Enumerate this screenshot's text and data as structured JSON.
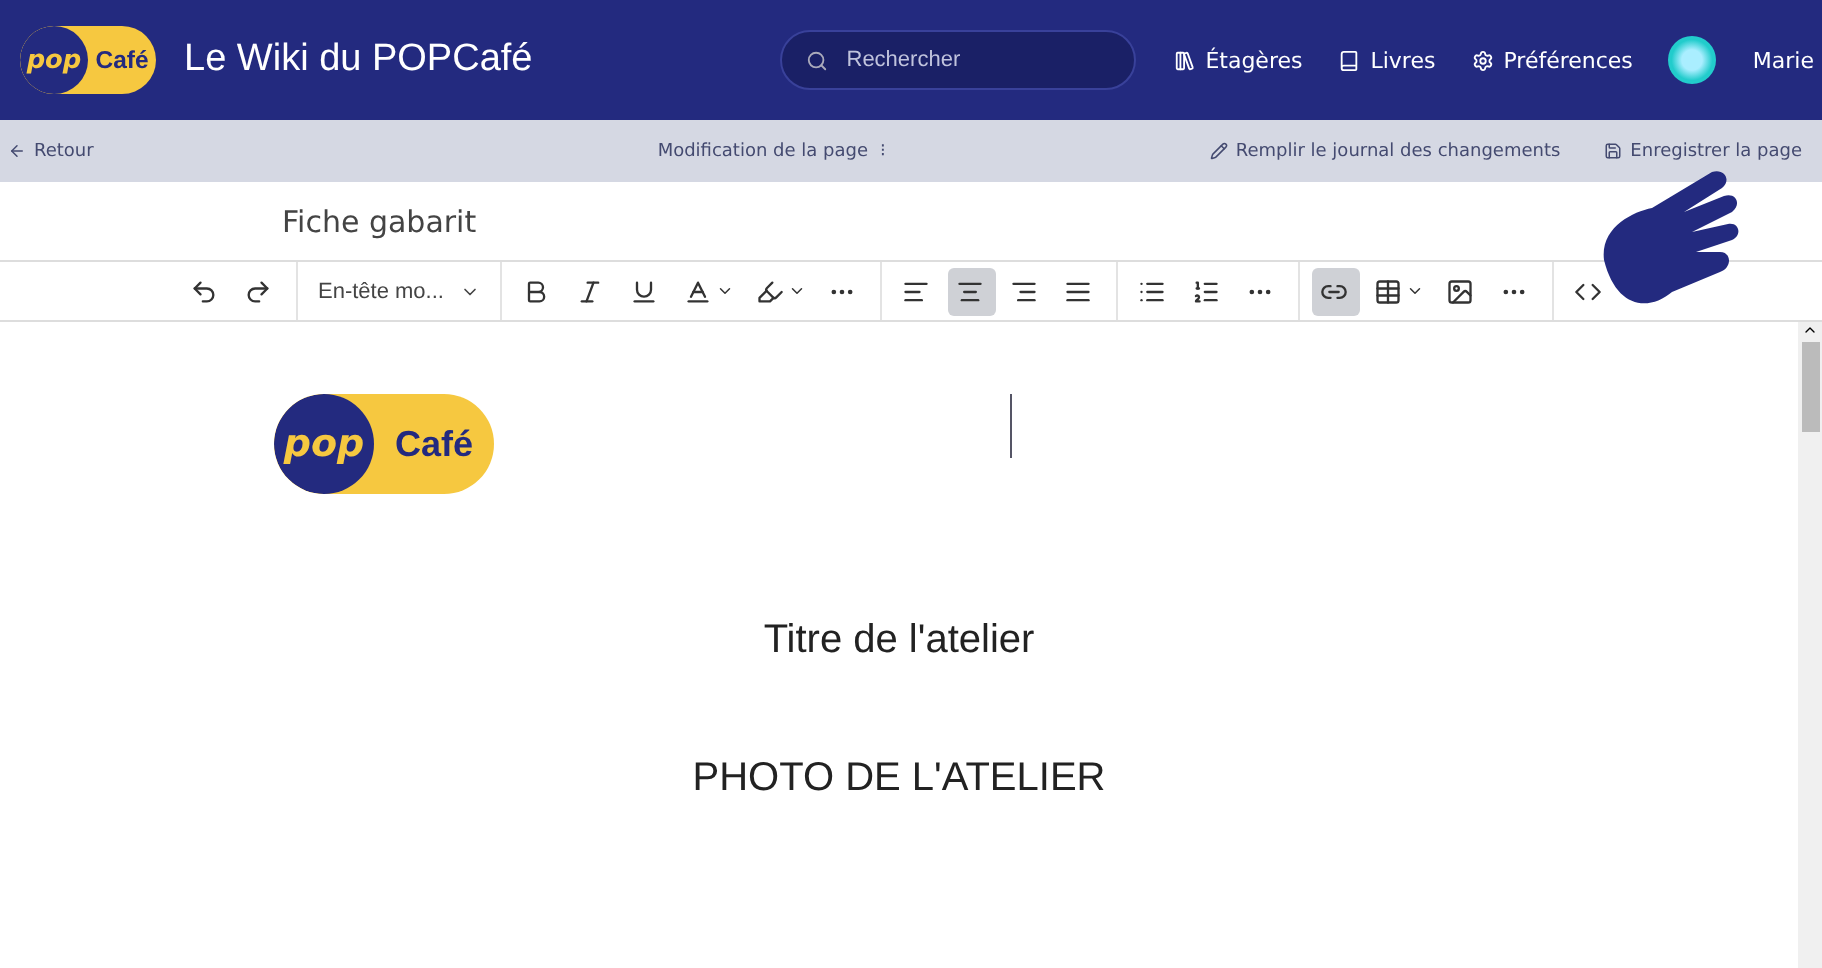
{
  "header": {
    "logo": {
      "mark": "pop",
      "word": "Café"
    },
    "title": "Le Wiki du POPCafé",
    "search": {
      "placeholder": "Rechercher"
    },
    "nav": [
      {
        "kind": "shelves",
        "label": "Étagères"
      },
      {
        "kind": "books",
        "label": "Livres"
      },
      {
        "kind": "settings",
        "label": "Préférences"
      }
    ],
    "user": {
      "name": "Marie"
    }
  },
  "subbar": {
    "back": "Retour",
    "center": "Modification de la page",
    "center_menu": "⁝",
    "actions": [
      {
        "kind": "changelog",
        "label": "Remplir le journal des changements"
      },
      {
        "kind": "save",
        "label": "Enregistrer la page"
      }
    ]
  },
  "page_name": "Fiche gabarit",
  "toolbar": [
    {
      "items": [
        {
          "kind": "undo",
          "selected": false
        },
        {
          "kind": "redo",
          "selected": false
        }
      ]
    },
    {
      "items": [
        {
          "kind": "select",
          "label": "En-tête mo..."
        }
      ]
    },
    {
      "items": [
        {
          "kind": "bold",
          "selected": false
        },
        {
          "kind": "italic",
          "selected": false
        },
        {
          "kind": "underline",
          "selected": false
        },
        {
          "kind": "textcolor",
          "selected": false
        },
        {
          "kind": "highlight",
          "selected": false
        },
        {
          "kind": "more",
          "selected": false
        }
      ]
    },
    {
      "items": [
        {
          "kind": "alignleft",
          "selected": false
        },
        {
          "kind": "aligncenter",
          "selected": true
        },
        {
          "kind": "alignright",
          "selected": false
        },
        {
          "kind": "justify",
          "selected": false
        }
      ]
    },
    {
      "items": [
        {
          "kind": "bullets",
          "selected": false
        },
        {
          "kind": "numbers",
          "selected": false
        },
        {
          "kind": "more",
          "selected": false
        }
      ]
    },
    {
      "items": [
        {
          "kind": "link",
          "selected": true
        },
        {
          "kind": "table",
          "selected": false
        },
        {
          "kind": "image",
          "selected": false
        },
        {
          "kind": "more",
          "selected": false
        }
      ]
    },
    {
      "items": [
        {
          "kind": "code",
          "selected": false
        }
      ]
    }
  ],
  "document": {
    "logo": {
      "mark": "pop",
      "word": "Café"
    },
    "paragraphs": [
      "Titre de l'atelier",
      "PHOTO DE L'ATELIER"
    ]
  }
}
